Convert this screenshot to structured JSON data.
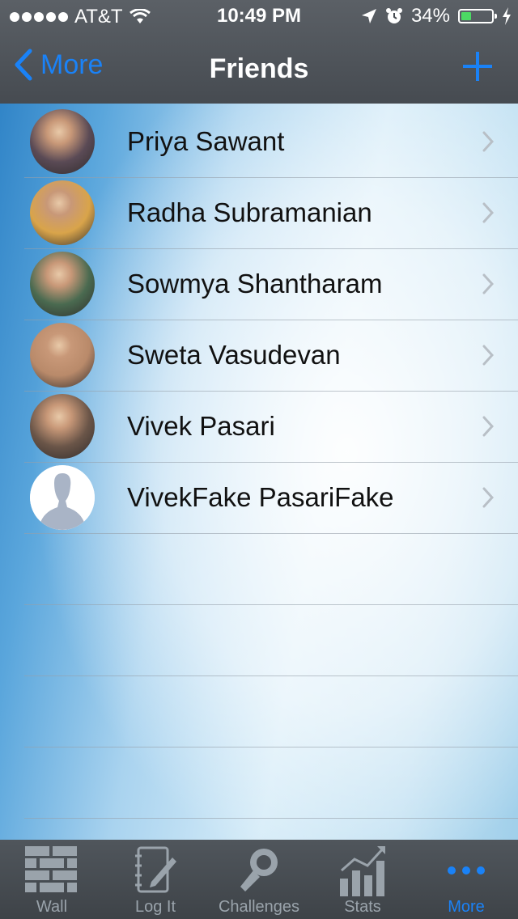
{
  "status_bar": {
    "carrier": "AT&T",
    "time": "10:49 PM",
    "battery_percent": "34%",
    "battery_level": 0.34
  },
  "nav": {
    "back_label": "More",
    "title": "Friends",
    "add_icon": "plus-icon"
  },
  "friends": [
    {
      "name": "Priya Sawant",
      "avatar_color": "#5a4a55"
    },
    {
      "name": "Radha Subramanian",
      "avatar_color": "#d9a44a"
    },
    {
      "name": "Sowmya Shantharam",
      "avatar_color": "#4a6a50"
    },
    {
      "name": "Sweta Vasudevan",
      "avatar_color": "#b98a6a"
    },
    {
      "name": "Vivek Pasari",
      "avatar_color": "#6a5548"
    },
    {
      "name": "VivekFake PasariFake",
      "avatar_color": "#a9b4c6"
    }
  ],
  "tabbar": {
    "tabs": [
      {
        "label": "Wall",
        "icon": "wall-icon"
      },
      {
        "label": "Log It",
        "icon": "notebook-icon"
      },
      {
        "label": "Challenges",
        "icon": "challenges-icon"
      },
      {
        "label": "Stats",
        "icon": "stats-icon"
      },
      {
        "label": "More",
        "icon": "more-icon"
      }
    ],
    "active": "More"
  },
  "colors": {
    "accent": "#1a82f7",
    "bar": "#4b5056",
    "battery_fill": "#4cd964"
  }
}
